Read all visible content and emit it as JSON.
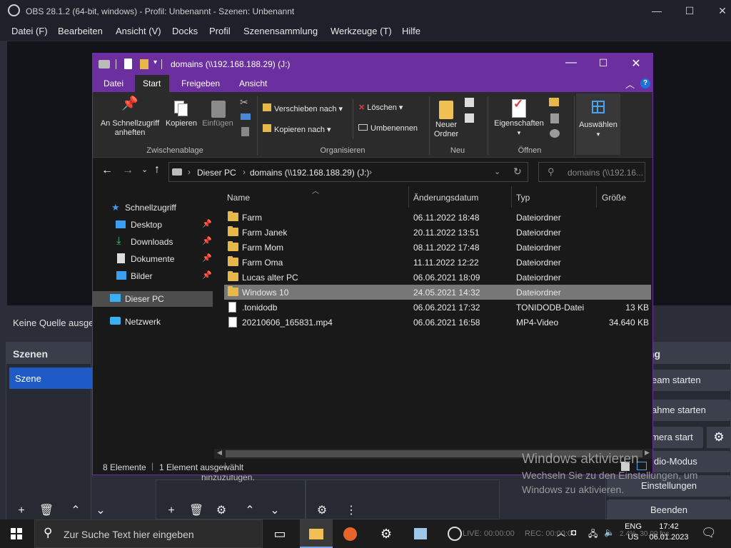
{
  "obs": {
    "title": "OBS 28.1.2 (64-bit, windows) - Profil: Unbenannt - Szenen: Unbenannt",
    "menu": [
      "Datei (F)",
      "Bearbeiten",
      "Ansicht (V)",
      "Docks",
      "Profil",
      "Szenensammlung",
      "Werkzeuge (T)",
      "Hilfe"
    ],
    "no_source_text": "Keine Quelle ausge",
    "scenes_header": "Szenen",
    "scene_item": "Szene",
    "controls_header": "ng",
    "controls": [
      "eam starten",
      "ahme starten",
      "amera start",
      "dio-Modus",
      "Einstellungen",
      "Beenden"
    ],
    "hint_text": "hinzuzufügen.",
    "stats": {
      "live": "LIVE: 00:00:00",
      "rec": "REC: 00:00:00",
      "cpu": "2.4%, 30.00 fps"
    }
  },
  "explorer": {
    "title": "domains (\\\\192.168.188.29) (J:)",
    "tabs": [
      "Datei",
      "Start",
      "Freigeben",
      "Ansicht"
    ],
    "ribbon": {
      "pin_label_1": "An Schnellzugriff",
      "pin_label_2": "anheften",
      "copy_label": "Kopieren",
      "paste_label": "Einfügen",
      "group_clipboard": "Zwischenablage",
      "move_to": "Verschieben nach",
      "copy_to": "Kopieren nach",
      "delete": "Löschen",
      "rename": "Umbenennen",
      "group_organize": "Organisieren",
      "new_folder_1": "Neuer",
      "new_folder_2": "Ordner",
      "group_new": "Neu",
      "properties": "Eigenschaften",
      "group_open": "Öffnen",
      "select": "Auswählen"
    },
    "address": {
      "part1": "Dieser PC",
      "part2": "domains (\\\\192.168.188.29) (J:)"
    },
    "search_placeholder": "domains (\\\\192.16...",
    "nav": {
      "quick_access": "Schnellzugriff",
      "desktop": "Desktop",
      "downloads": "Downloads",
      "documents": "Dokumente",
      "pictures": "Bilder",
      "this_pc": "Dieser PC",
      "network": "Netzwerk"
    },
    "columns": {
      "name": "Name",
      "date": "Änderungsdatum",
      "type": "Typ",
      "size": "Größe"
    },
    "files": [
      {
        "name": "Farm",
        "date": "06.11.2022 18:48",
        "type": "Dateiordner",
        "size": "",
        "kind": "folder"
      },
      {
        "name": "Farm Janek",
        "date": "20.11.2022 13:51",
        "type": "Dateiordner",
        "size": "",
        "kind": "folder"
      },
      {
        "name": "Farm Mom",
        "date": "08.11.2022 17:48",
        "type": "Dateiordner",
        "size": "",
        "kind": "folder"
      },
      {
        "name": "Farm Oma",
        "date": "11.11.2022 12:22",
        "type": "Dateiordner",
        "size": "",
        "kind": "folder"
      },
      {
        "name": "Lucas alter PC",
        "date": "06.06.2021 18:09",
        "type": "Dateiordner",
        "size": "",
        "kind": "folder"
      },
      {
        "name": "Windows 10",
        "date": "24.05.2021 14:32",
        "type": "Dateiordner",
        "size": "",
        "kind": "folder",
        "selected": true
      },
      {
        "name": ".tonidodb",
        "date": "06.06.2021 17:32",
        "type": "TONIDODB-Datei",
        "size": "13 KB",
        "kind": "file"
      },
      {
        "name": "20210606_165831.mp4",
        "date": "06.06.2021 16:58",
        "type": "MP4-Video",
        "size": "34.640 KB",
        "kind": "video"
      }
    ],
    "status_count": "8 Elemente",
    "status_selected": "1 Element ausgewählt"
  },
  "watermark": {
    "title": "Windows aktivieren",
    "line1": "Wechseln Sie zu den Einstellungen, um",
    "line2": "Windows zu aktivieren."
  },
  "taskbar": {
    "search_placeholder": "Zur Suche Text hier eingeben",
    "lang_1": "ENG",
    "lang_2": "US",
    "time": "17:42",
    "date": "06.01.2023"
  },
  "colors": {
    "explorer_accent": "#6b2fa0",
    "obs_scene_selected": "#1e5bc6",
    "selection": "#777777"
  }
}
